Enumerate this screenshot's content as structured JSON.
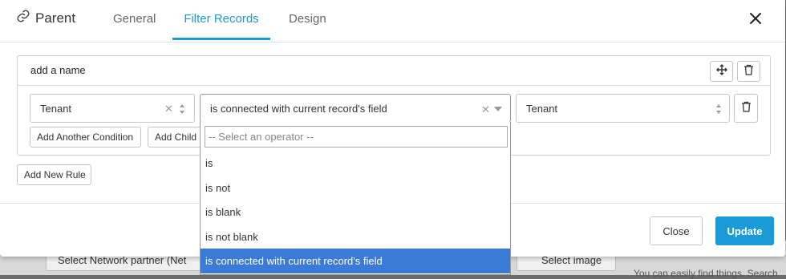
{
  "background": {
    "button1_label": "Select Network partner (Net",
    "button2_label": "Select image",
    "text": "You can easily find things. Search"
  },
  "header": {
    "title": "Parent",
    "tabs": [
      {
        "label": "General",
        "active": false
      },
      {
        "label": "Filter Records",
        "active": true
      },
      {
        "label": "Design",
        "active": false
      }
    ]
  },
  "rule": {
    "name_placeholder": "add a name",
    "field_value": "Tenant",
    "operator_value": "is connected with current record's field",
    "target_value": "Tenant",
    "add_condition_label": "Add Another Condition",
    "add_child_label": "Add Child"
  },
  "add_rule_label": "Add New Rule",
  "dropdown": {
    "search_placeholder": "-- Select an operator --",
    "options": [
      "is",
      "is not",
      "is blank",
      "is not blank",
      "is connected with current record's field"
    ],
    "selected_index": 4
  },
  "footer": {
    "close_label": "Close",
    "update_label": "Update"
  },
  "colors": {
    "accent": "#1a9ad6",
    "selected_option": "#3b7bd6"
  }
}
